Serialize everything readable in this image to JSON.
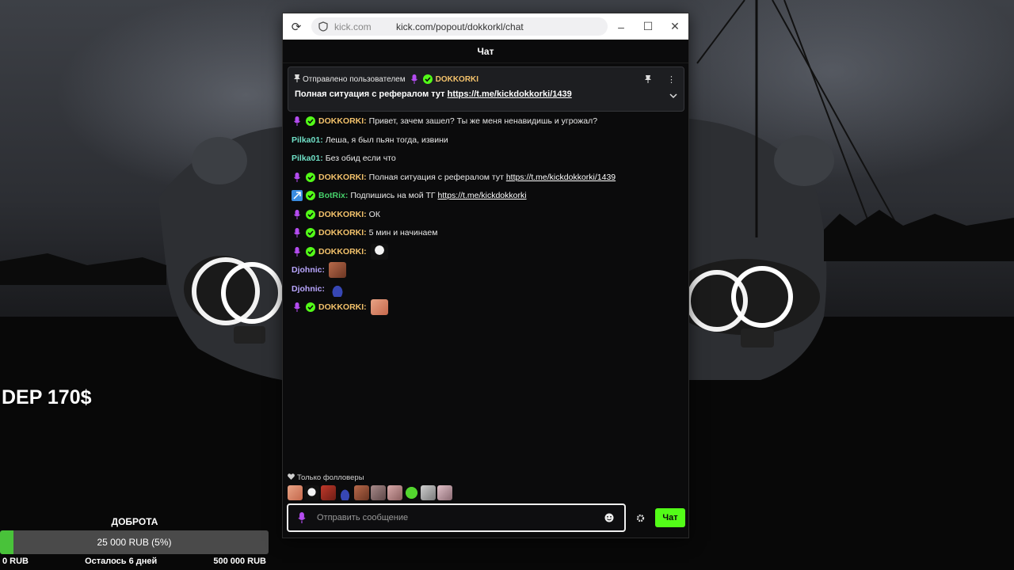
{
  "background": {
    "dep_text": "DEP 170$"
  },
  "goal": {
    "title": "ДОБРОТА",
    "amount": "25 000 RUB (5%)",
    "progress_fraction": 0.05,
    "min": "0 RUB",
    "remaining": "Осталось 6 дней",
    "max": "500 000 RUB",
    "fill_color": "#49c23a"
  },
  "browser": {
    "domain": "kick.com",
    "url": "kick.com/popout/dokkorkl/chat"
  },
  "chat": {
    "header": "Чат",
    "pinned": {
      "sent_by": "Отправлено пользователем",
      "username": "DOKKORKI",
      "text": "Полная ситуация с рефералом тут",
      "link": "https://t.me/kickdokkorki/1439"
    },
    "messages": [
      {
        "username": "DOKKORKI",
        "text": "Привет, зачем зашел? Ты же меня ненавидишь и угрожал?"
      },
      {
        "username": "Pilka01",
        "text": "Леша, я был пьян тогда, извини"
      },
      {
        "username": "Pilka01",
        "text": "Без обид если что"
      },
      {
        "username": "DOKKORKI",
        "text": "Полная ситуация с рефералом тут",
        "link": "https://t.me/kickdokkorki/1439"
      },
      {
        "username": "BotRix",
        "text": "Подпишись на мой ТГ",
        "link": "https://t.me/kickdokkorki"
      },
      {
        "username": "DOKKORKI",
        "text": "ОК"
      },
      {
        "username": "DOKKORKI",
        "text": "5 мин и начинаем"
      },
      {
        "username": "DOKKORKI",
        "text": ""
      },
      {
        "username": "Djohnic",
        "text": ""
      },
      {
        "username": "Djohnic",
        "text": ""
      },
      {
        "username": "DOKKORKI",
        "text": ""
      }
    ],
    "followers_only": "Только фолловеры",
    "input_placeholder": "Отправить сообщение",
    "send_label": "Чат"
  },
  "colors": {
    "kick_green": "#53fc18",
    "dokkorki": "#f3c26b",
    "pilka": "#6fe0c7",
    "botrix": "#46d06a",
    "djohnic": "#b9a6ff"
  }
}
